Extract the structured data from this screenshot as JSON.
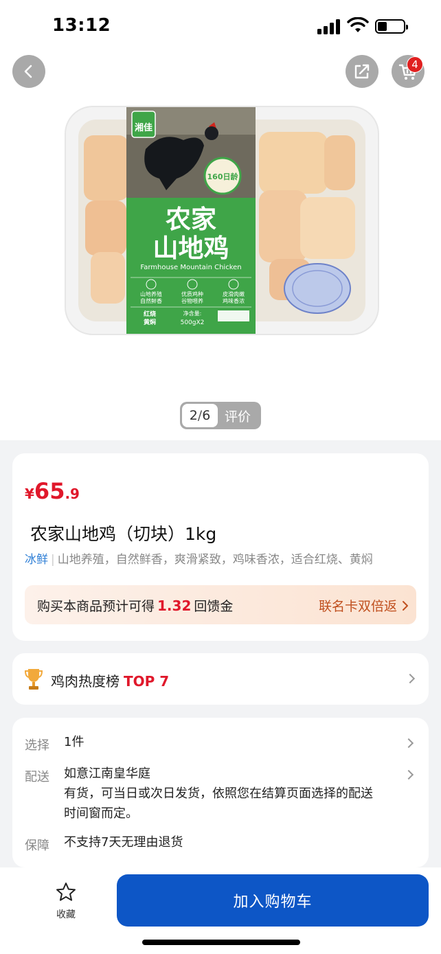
{
  "status_bar": {
    "time": "13:12"
  },
  "header": {
    "cart_count": "4"
  },
  "gallery": {
    "current": "2",
    "separator": "/",
    "total": "6",
    "review_label": "评价",
    "package": {
      "brand": "湘佳",
      "title_line1": "农家",
      "title_line2": "山地鸡",
      "title_en": "Farmhouse Mountain Chicken",
      "badge": "160日龄",
      "features": [
        "山地养殖\n自然鲜香",
        "优质鸡种\n谷物喂养",
        "皮滑肉嫩\n鸡味香浓"
      ],
      "cooking": "红烧\n黄焖",
      "net_label": "净含量:",
      "net_value": "500gX2"
    }
  },
  "product": {
    "price_symbol": "¥",
    "price_integer": "65",
    "price_decimal": ".9",
    "title": "农家山地鸡（切块）1kg",
    "tag": "冰鲜",
    "divider": "|",
    "description": "山地养殖，自然鲜香，爽滑紧致，鸡味香浓，适合红烧、黄焖",
    "cashback_prefix": "购买本商品预计可得",
    "cashback_amount": "1.32",
    "cashback_suffix": "回馈金",
    "cashback_link": "联名卡双倍返"
  },
  "ranking": {
    "label": "鸡肉热度榜",
    "rank": "TOP 7"
  },
  "specs": {
    "select_label": "选择",
    "select_value": "1件",
    "delivery_label": "配送",
    "delivery_address": "如意江南皇华庭",
    "delivery_note_line1": "有货，可当日或次日发货，依照您在结算页面选择的配送",
    "delivery_note_line2": "时间窗而定。",
    "guarantee_label": "保障",
    "guarantee_value": "不支持7天无理由退货"
  },
  "bottom_bar": {
    "favorite_label": "收藏",
    "add_to_cart_label": "加入购物车"
  },
  "colors": {
    "price_red": "#e0182b",
    "primary_blue": "#0d56c6",
    "tag_blue": "#2f7fd6",
    "package_green": "#3fa548"
  },
  "icons": [
    "back-arrow-icon",
    "share-icon",
    "cart-icon",
    "trophy-icon",
    "star-icon",
    "chevron-right-icon"
  ]
}
